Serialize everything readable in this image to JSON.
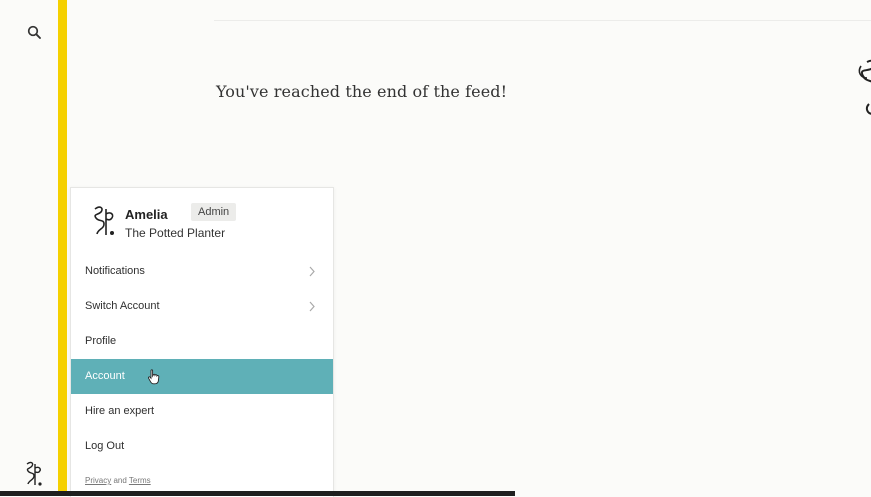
{
  "rail": {
    "search_icon": "search-icon",
    "logo_icon": "brand-logo-icon"
  },
  "feed": {
    "end_message": "You've reached the end of the feed!"
  },
  "account_menu": {
    "user": {
      "name": "Amelia",
      "role_badge": "Admin",
      "shop_name": "The Potted Planter"
    },
    "items": [
      {
        "label": "Notifications",
        "has_submenu": true
      },
      {
        "label": "Switch Account",
        "has_submenu": true
      },
      {
        "label": "Profile",
        "has_submenu": false
      },
      {
        "label": "Account",
        "has_submenu": false,
        "active": true
      },
      {
        "label": "Hire an expert",
        "has_submenu": false
      },
      {
        "label": "Log Out",
        "has_submenu": false
      }
    ],
    "footer": {
      "privacy": "Privacy",
      "and": "and",
      "terms": "Terms"
    }
  },
  "colors": {
    "accent_yellow": "#f5d000",
    "active_item": "#5fb0b7",
    "background": "#fbfbf9"
  }
}
